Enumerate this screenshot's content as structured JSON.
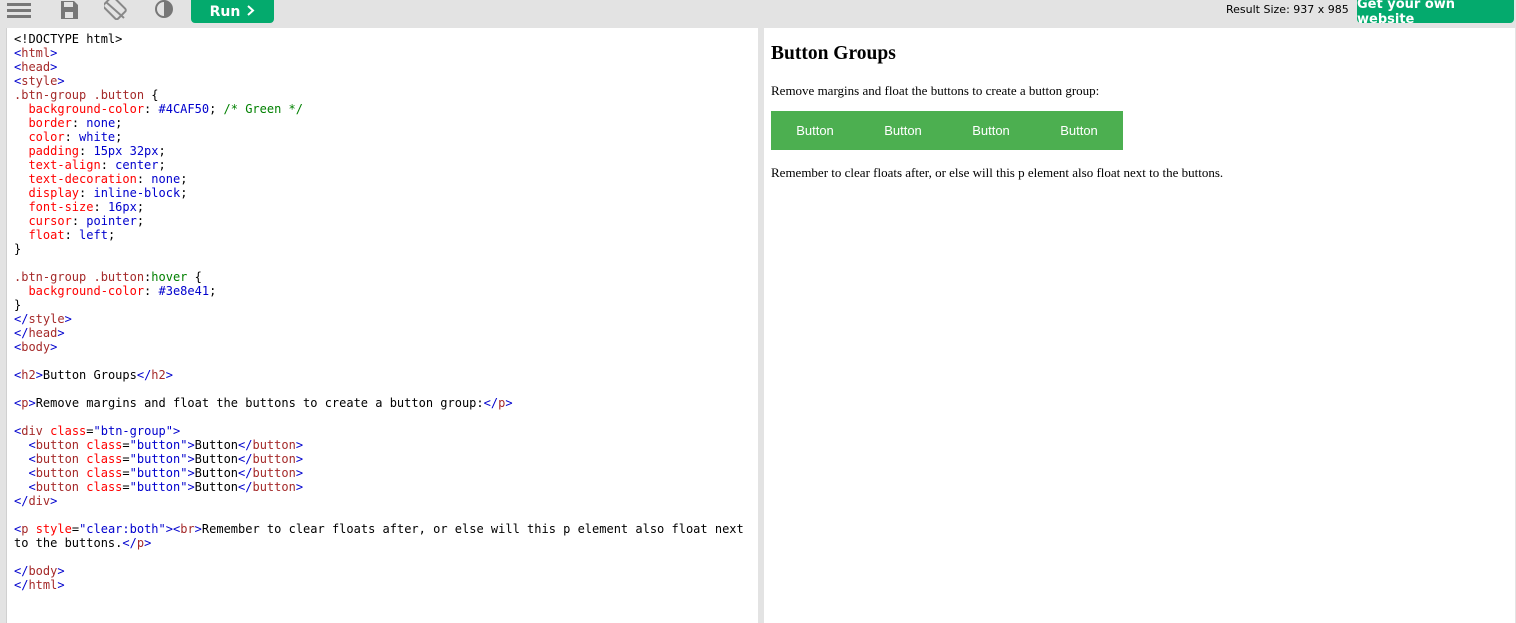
{
  "toolbar": {
    "menu_icon": "hamburger-menu-icon",
    "save_icon": "save-icon",
    "rotate_icon": "rotate-layout-icon",
    "theme_icon": "contrast-icon",
    "run_label": "Run",
    "run_icon": "chevron-right-icon",
    "result_size": "Result Size: 937 x 985",
    "get_site_label": "Get your own website",
    "accent": "#04aa6d"
  },
  "code": [
    [
      [
        "",
        "<!DOCTYPE html>"
      ]
    ],
    [
      [
        "c-br",
        "<"
      ],
      [
        "c-tag",
        "html"
      ],
      [
        "c-br",
        ">"
      ]
    ],
    [
      [
        "c-br",
        "<"
      ],
      [
        "c-tag",
        "head"
      ],
      [
        "c-br",
        ">"
      ]
    ],
    [
      [
        "c-br",
        "<"
      ],
      [
        "c-tag",
        "style"
      ],
      [
        "c-br",
        ">"
      ]
    ],
    [
      [
        "c-sel",
        ".btn-group .button"
      ],
      [
        "",
        " {"
      ]
    ],
    [
      [
        "",
        "  "
      ],
      [
        "c-prop",
        "background-color"
      ],
      [
        "",
        ": "
      ],
      [
        "c-pval",
        "#4CAF50"
      ],
      [
        "",
        "; "
      ],
      [
        "c-cmt",
        "/* Green */"
      ]
    ],
    [
      [
        "",
        "  "
      ],
      [
        "c-prop",
        "border"
      ],
      [
        "",
        ": "
      ],
      [
        "c-pval",
        "none"
      ],
      [
        "",
        ";"
      ]
    ],
    [
      [
        "",
        "  "
      ],
      [
        "c-prop",
        "color"
      ],
      [
        "",
        ": "
      ],
      [
        "c-pval",
        "white"
      ],
      [
        "",
        ";"
      ]
    ],
    [
      [
        "",
        "  "
      ],
      [
        "c-prop",
        "padding"
      ],
      [
        "",
        ": "
      ],
      [
        "c-pval",
        "15px 32px"
      ],
      [
        "",
        ";"
      ]
    ],
    [
      [
        "",
        "  "
      ],
      [
        "c-prop",
        "text-align"
      ],
      [
        "",
        ": "
      ],
      [
        "c-pval",
        "center"
      ],
      [
        "",
        ";"
      ]
    ],
    [
      [
        "",
        "  "
      ],
      [
        "c-prop",
        "text-decoration"
      ],
      [
        "",
        ": "
      ],
      [
        "c-pval",
        "none"
      ],
      [
        "",
        ";"
      ]
    ],
    [
      [
        "",
        "  "
      ],
      [
        "c-prop",
        "display"
      ],
      [
        "",
        ": "
      ],
      [
        "c-pval",
        "inline-block"
      ],
      [
        "",
        ";"
      ]
    ],
    [
      [
        "",
        "  "
      ],
      [
        "c-prop",
        "font-size"
      ],
      [
        "",
        ": "
      ],
      [
        "c-pval",
        "16px"
      ],
      [
        "",
        ";"
      ]
    ],
    [
      [
        "",
        "  "
      ],
      [
        "c-prop",
        "cursor"
      ],
      [
        "",
        ": "
      ],
      [
        "c-pval",
        "pointer"
      ],
      [
        "",
        ";"
      ]
    ],
    [
      [
        "",
        "  "
      ],
      [
        "c-prop",
        "float"
      ],
      [
        "",
        ": "
      ],
      [
        "c-pval",
        "left"
      ],
      [
        "",
        ";"
      ]
    ],
    [
      [
        "",
        "}"
      ]
    ],
    [
      [
        "",
        ""
      ]
    ],
    [
      [
        "c-sel",
        ".btn-group .button"
      ],
      [
        "",
        ":"
      ],
      [
        "c-pseudo",
        "hover"
      ],
      [
        "",
        " {"
      ]
    ],
    [
      [
        "",
        "  "
      ],
      [
        "c-prop",
        "background-color"
      ],
      [
        "",
        ": "
      ],
      [
        "c-pval",
        "#3e8e41"
      ],
      [
        "",
        ";"
      ]
    ],
    [
      [
        "",
        "}"
      ]
    ],
    [
      [
        "c-br",
        "</"
      ],
      [
        "c-tag",
        "style"
      ],
      [
        "c-br",
        ">"
      ]
    ],
    [
      [
        "c-br",
        "</"
      ],
      [
        "c-tag",
        "head"
      ],
      [
        "c-br",
        ">"
      ]
    ],
    [
      [
        "c-br",
        "<"
      ],
      [
        "c-tag",
        "body"
      ],
      [
        "c-br",
        ">"
      ]
    ],
    [
      [
        "",
        ""
      ]
    ],
    [
      [
        "c-br",
        "<"
      ],
      [
        "c-tag",
        "h2"
      ],
      [
        "c-br",
        ">"
      ],
      [
        "",
        "Button Groups"
      ],
      [
        "c-br",
        "</"
      ],
      [
        "c-tag",
        "h2"
      ],
      [
        "c-br",
        ">"
      ]
    ],
    [
      [
        "",
        ""
      ]
    ],
    [
      [
        "c-br",
        "<"
      ],
      [
        "c-tag",
        "p"
      ],
      [
        "c-br",
        ">"
      ],
      [
        "",
        "Remove margins and float the buttons to create a button group:"
      ],
      [
        "c-br",
        "</"
      ],
      [
        "c-tag",
        "p"
      ],
      [
        "c-br",
        ">"
      ]
    ],
    [
      [
        "",
        ""
      ]
    ],
    [
      [
        "c-br",
        "<"
      ],
      [
        "c-tag",
        "div"
      ],
      [
        "c-attr",
        " class"
      ],
      [
        "",
        "="
      ],
      [
        "c-val",
        "\"btn-group\""
      ],
      [
        "c-br",
        ">"
      ]
    ],
    [
      [
        "",
        "  "
      ],
      [
        "c-br",
        "<"
      ],
      [
        "c-tag",
        "button"
      ],
      [
        "c-attr",
        " class"
      ],
      [
        "",
        "="
      ],
      [
        "c-val",
        "\"button\""
      ],
      [
        "c-br",
        ">"
      ],
      [
        "",
        "Button"
      ],
      [
        "c-br",
        "</"
      ],
      [
        "c-tag",
        "button"
      ],
      [
        "c-br",
        ">"
      ]
    ],
    [
      [
        "",
        "  "
      ],
      [
        "c-br",
        "<"
      ],
      [
        "c-tag",
        "button"
      ],
      [
        "c-attr",
        " class"
      ],
      [
        "",
        "="
      ],
      [
        "c-val",
        "\"button\""
      ],
      [
        "c-br",
        ">"
      ],
      [
        "",
        "Button"
      ],
      [
        "c-br",
        "</"
      ],
      [
        "c-tag",
        "button"
      ],
      [
        "c-br",
        ">"
      ]
    ],
    [
      [
        "",
        "  "
      ],
      [
        "c-br",
        "<"
      ],
      [
        "c-tag",
        "button"
      ],
      [
        "c-attr",
        " class"
      ],
      [
        "",
        "="
      ],
      [
        "c-val",
        "\"button\""
      ],
      [
        "c-br",
        ">"
      ],
      [
        "",
        "Button"
      ],
      [
        "c-br",
        "</"
      ],
      [
        "c-tag",
        "button"
      ],
      [
        "c-br",
        ">"
      ]
    ],
    [
      [
        "",
        "  "
      ],
      [
        "c-br",
        "<"
      ],
      [
        "c-tag",
        "button"
      ],
      [
        "c-attr",
        " class"
      ],
      [
        "",
        "="
      ],
      [
        "c-val",
        "\"button\""
      ],
      [
        "c-br",
        ">"
      ],
      [
        "",
        "Button"
      ],
      [
        "c-br",
        "</"
      ],
      [
        "c-tag",
        "button"
      ],
      [
        "c-br",
        ">"
      ]
    ],
    [
      [
        "c-br",
        "</"
      ],
      [
        "c-tag",
        "div"
      ],
      [
        "c-br",
        ">"
      ]
    ],
    [
      [
        "",
        ""
      ]
    ],
    [
      [
        "c-br",
        "<"
      ],
      [
        "c-tag",
        "p"
      ],
      [
        "c-attr",
        " style"
      ],
      [
        "",
        "="
      ],
      [
        "c-val",
        "\"clear:both\""
      ],
      [
        "c-br",
        "><"
      ],
      [
        "c-tag",
        "br"
      ],
      [
        "c-br",
        ">"
      ],
      [
        "",
        "Remember to clear floats after, or else will this p element also float next"
      ]
    ],
    [
      [
        "",
        "to the buttons."
      ],
      [
        "c-br",
        "</"
      ],
      [
        "c-tag",
        "p"
      ],
      [
        "c-br",
        ">"
      ]
    ],
    [
      [
        "",
        ""
      ]
    ],
    [
      [
        "c-br",
        "</"
      ],
      [
        "c-tag",
        "body"
      ],
      [
        "c-br",
        ">"
      ]
    ],
    [
      [
        "c-br",
        "</"
      ],
      [
        "c-tag",
        "html"
      ],
      [
        "c-br",
        ">"
      ]
    ]
  ],
  "result": {
    "heading": "Button Groups",
    "intro": "Remove margins and float the buttons to create a button group:",
    "buttons": [
      "Button",
      "Button",
      "Button",
      "Button"
    ],
    "button_color": "#4caf50",
    "after": "Remember to clear floats after, or else will this p element also float next to the buttons."
  }
}
